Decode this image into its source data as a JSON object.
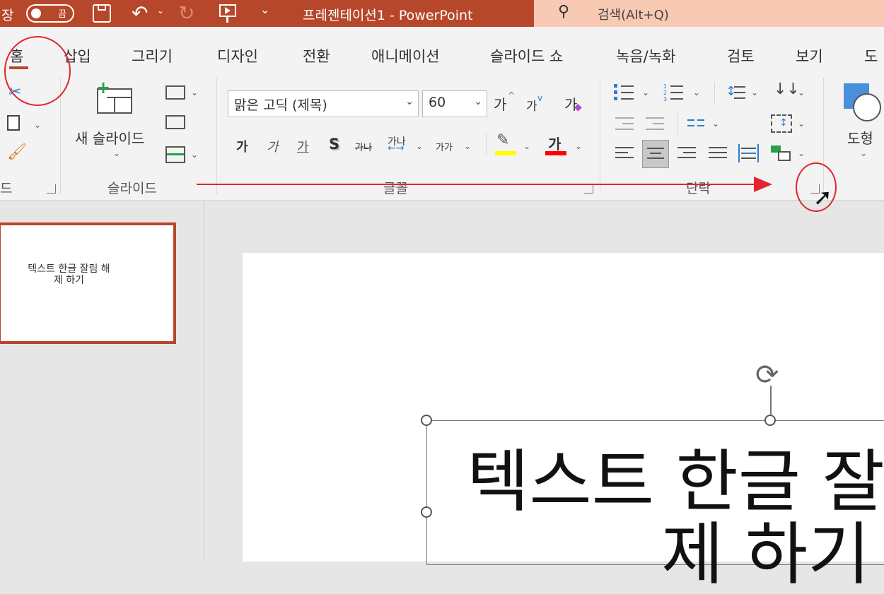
{
  "titlebar": {
    "autosave_label": "장",
    "toggle_state": "끔",
    "title": "프레젠테이션1  -  PowerPoint",
    "search_placeholder": "검색(Alt+Q)"
  },
  "tabs": [
    "홈",
    "삽입",
    "그리기",
    "디자인",
    "전환",
    "애니메이션",
    "슬라이드 쇼",
    "녹음/녹화",
    "검토",
    "보기",
    "도"
  ],
  "ribbon": {
    "clipboard_label": "드",
    "new_slide_label": "새 슬라이드",
    "slides_group": "슬라이드",
    "font_name": "맑은 고딕 (제목)",
    "font_size": "60",
    "grow_font": "가",
    "shrink_font": "가",
    "clear_format": "가",
    "bold": "가",
    "italic": "가",
    "underline": "가",
    "shadow": "S",
    "strike": "가나",
    "spacing": "가나",
    "change_case": "가가",
    "font_color": "가",
    "font_group": "글꼴",
    "paragraph_group": "단락",
    "shapes_label": "도형"
  },
  "slide_thumb": {
    "line1": "텍스트 한글 잘림 해",
    "line2": "제 하기"
  },
  "slide": {
    "title_line1": "텍스트 한글 잘",
    "title_line2": "제 하기"
  },
  "colors": {
    "accent": "#b7472a",
    "annotation": "#e0252d",
    "highlight": "#ffff00",
    "font_red": "#ff0000"
  }
}
